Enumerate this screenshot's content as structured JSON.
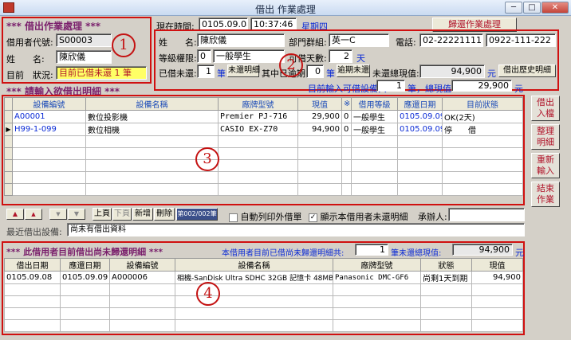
{
  "window": {
    "title": "借出 作業處理",
    "min_label": "─",
    "max_label": "□",
    "close_label": "✕"
  },
  "borrower": {
    "header": "***  借出作業處理  ***",
    "id_label": "借用者代號:",
    "id_value": "S00003",
    "name_label": "姓　　名:",
    "name_value": "陳欣儀",
    "status_label": "目前　狀況:",
    "status_value": "目前已借未還 1 筆"
  },
  "clock": {
    "label": "現在時間:",
    "date": "0105.09.08",
    "time": "10:37:46",
    "weekday": "星期四"
  },
  "return_button": "歸還作業處理",
  "info": {
    "name_label": "姓　　名:",
    "name_value": "陳欣儀",
    "dept_label": "部門群組:",
    "dept_value": "英一C",
    "phone_label": "電話:",
    "phone1": "02-22221111",
    "phone2": "0922-111-222",
    "level_label": "等級權限:",
    "level_code": "0",
    "level_value": "一般學生",
    "days_label": "可借天數:",
    "days_value": "2",
    "days_unit": "天",
    "borrowed_label": "已借未還:",
    "borrowed_count": "1",
    "borrowed_unit": "筆",
    "detail_btn": "未還明細",
    "overdue_label": "其中已逾期:",
    "overdue_count": "0",
    "overdue_unit": "筆",
    "overdue_btn": "逾期未還",
    "unreturned_label": "未還總現值:",
    "unreturned_value": "94,900",
    "currency": "元",
    "history_btn": "借出歷史明細",
    "summary_label": "目前輸入可借設備共:",
    "summary_count": "1",
    "summary_total_label": "筆，總現值:",
    "summary_total": "29,900",
    "summary_currency": "元"
  },
  "input_header": "***  請輸入欲借出明細  ***",
  "borrow_table": {
    "columns": [
      "設備編號",
      "設備名稱",
      "廠牌型號",
      "現值",
      "※",
      "借用等級",
      "應還日期",
      "目前狀態"
    ],
    "rows": [
      [
        "A00001",
        "數位投影機",
        "Premier PJ-716",
        "29,900",
        "0",
        "一般學生",
        "0105.09.09",
        "OK(2天)"
      ],
      [
        "H99-1-099",
        "數位相機",
        "CASIO EX-Z70",
        "94,900",
        "0",
        "一般學生",
        "0105.09.09",
        "停　　借"
      ]
    ],
    "empty_rows": 5
  },
  "side_buttons": [
    {
      "line1": "借出",
      "line2": "入檔"
    },
    {
      "line1": "整理",
      "line2": "明細"
    },
    {
      "line1": "重新",
      "line2": "輸入"
    },
    {
      "line1": "結束",
      "line2": "作業"
    }
  ],
  "nav": {
    "first": "▲",
    "prev": "▲",
    "next": "▼",
    "last": "▼",
    "page_up": "上頁",
    "page_down": "下頁",
    "add": "新增",
    "delete": "刪除",
    "counter": "第002/002筆",
    "auto_print_label": "自動列印外借單",
    "auto_print_checked": "",
    "show_unreturned_label": "顯示本借用者未還明細",
    "show_unreturned_checked": "✓",
    "handler_label": "承辦人:",
    "handler_value": ""
  },
  "recent": {
    "label": "最近借出設備:",
    "value": "尚未有借出資料"
  },
  "unreturned": {
    "header": "***  此借用者目前借出尚未歸還明細  ***",
    "summary_label": "本借用者目前已借尚未歸還明細共:",
    "count": "1",
    "total_label": "筆未還總現值:",
    "total": "94,900",
    "currency": "元",
    "columns": [
      "借出日期",
      "應還日期",
      "設備編號",
      "設備名稱",
      "廠牌型號",
      "狀態",
      "現值"
    ],
    "rows": [
      [
        "0105.09.08",
        "0105.09.09",
        "A000006",
        "相機-SanDisk Ultra SDHC 32GB 記憶卡 48MB",
        "Panasonic DMC-GF6",
        "尚剩1天到期",
        "94,900"
      ]
    ],
    "empty_rows": 4
  },
  "annotations": {
    "n1": "1",
    "n2": "2",
    "n3": "3",
    "n4": "4"
  }
}
